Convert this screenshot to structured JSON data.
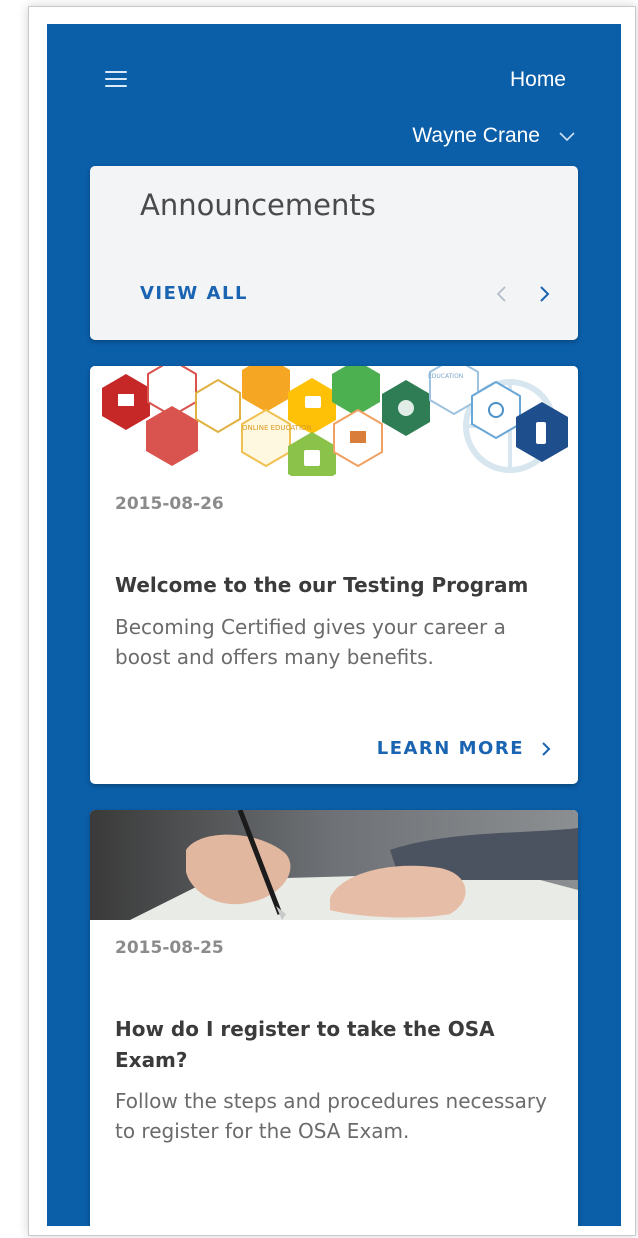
{
  "header": {
    "menu_icon": "hamburger-icon",
    "nav_label": "Home",
    "user_name": "Wayne Crane",
    "user_dropdown_icon": "chevron-down-icon"
  },
  "announcements": {
    "title": "Announcements",
    "view_all_label": "VIEW ALL",
    "prev_icon": "chevron-left-icon",
    "next_icon": "chevron-right-icon"
  },
  "news": [
    {
      "date": "2015-08-26",
      "title": "Welcome to the our Testing Program",
      "summary": "Becoming Certified gives your career a boost and offers many benefits.",
      "cta": "LEARN MORE",
      "image_label_1": "ONLINE EDUCATION",
      "image_label_2": "EDUCATION"
    },
    {
      "date": "2015-08-25",
      "title": "How do I register to take the OSA Exam?",
      "summary": "Follow the steps and procedures necessary to register for the OSA Exam."
    }
  ],
  "colors": {
    "background": "#0b5ea8",
    "accent": "#1a64b1",
    "card": "#ffffff",
    "announcement_card": "#f3f4f6"
  }
}
